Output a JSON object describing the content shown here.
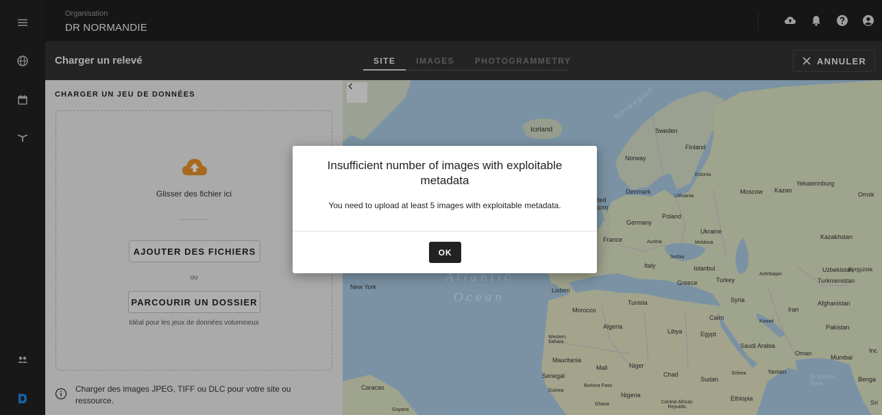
{
  "header": {
    "org_label": "Organisation",
    "org_name": "DR NORMANDIE",
    "icons": [
      "cloud-upload-icon",
      "bell-icon",
      "help-icon",
      "account-icon"
    ]
  },
  "rail": {
    "icons": [
      "menu-icon",
      "globe-icon",
      "calendar-icon",
      "drone-icon",
      "users-icon",
      "brand-logo"
    ]
  },
  "subheader": {
    "title": "Charger un relevé",
    "tabs": [
      {
        "label": "SITE",
        "active": true
      },
      {
        "label": "IMAGES",
        "active": false
      },
      {
        "label": "PHOTOGRAMMETRY",
        "active": false
      }
    ],
    "cancel_label": "ANNULER"
  },
  "panel": {
    "title": "CHARGER UN JEU DE DONNÉES",
    "drop_text": "Glisser des fichier ici",
    "add_files_label": "AJOUTER DES FICHIERS",
    "or_text": "ou",
    "browse_label": "PARCOURIR UN DOSSIER",
    "hint": "Idéal pour les jeux de données volumineux",
    "info": "Charger des images JPEG, TIFF ou DLC pour votre site ou ressource."
  },
  "map": {
    "labels": [
      "Iceland",
      "Sweden",
      "Finland",
      "Norway",
      "Estonia",
      "Denmark",
      "Lithuania",
      "Moscow",
      "Kazan",
      "Yekaterinburg",
      "Omsk",
      "ited",
      "dom",
      "Poland",
      "Germany",
      "Ukraine",
      "Kazakhstan",
      "France",
      "Austria",
      "Moldova",
      "Serbia",
      "Italy",
      "Istanbul",
      "Azerbaijan",
      "Uzbekistan",
      "Kyrgyzsta",
      "Turkmenistan",
      "New York",
      "Greece",
      "Turkey",
      "Lisbon",
      "Tunisia",
      "Syria",
      "Iran",
      "Afghanistan",
      "Morocco",
      "Cairo",
      "Kuwait",
      "Algeria",
      "Libya",
      "Egypt",
      "Pakistan",
      "Western Sahara",
      "Saudi Arabia",
      "Oman",
      "Mauritania",
      "Mali",
      "Niger",
      "Chad",
      "Eritrea",
      "Yemen",
      "Senegal",
      "Sudan",
      "Guinea",
      "Burkina Faso",
      "Nigeria",
      "Ethiopia",
      "Central African Republic",
      "Ghana",
      "Caracas",
      "Guyana",
      "Mumbai",
      "Benga",
      "Sri",
      "Inc"
    ],
    "ocean_line1": "Atlantic",
    "ocean_line2": "Ocean",
    "sea_label": "Norwegian",
    "arabian_sea": "Arabian Sea"
  },
  "dialog": {
    "title": "Insufficient number of images with exploitable metadata",
    "message": "You need to upload at least 5 images with exploitable metadata.",
    "ok_label": "OK"
  },
  "colors": {
    "accent": "#e8942a",
    "brand": "#1e88e5",
    "rail_bg": "#222222"
  }
}
